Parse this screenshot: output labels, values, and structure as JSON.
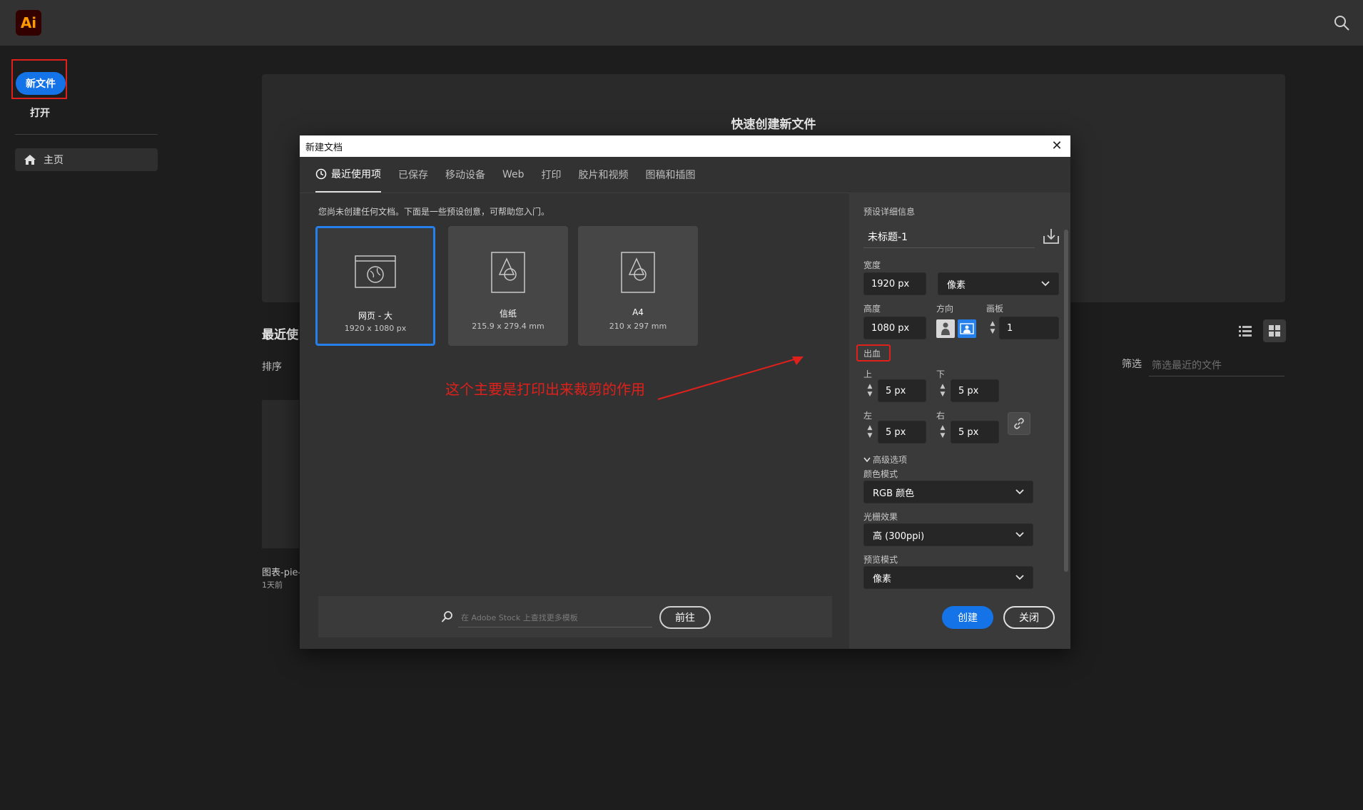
{
  "app": {
    "logo_text": "Ai"
  },
  "sidebar": {
    "new_file_label": "新文件",
    "open_label": "打开",
    "home_label": "主页"
  },
  "home": {
    "hero_title": "快速创建新文件",
    "recent_title": "最近使",
    "sort_label": "排序",
    "recent_item_name": "图表-pie-",
    "recent_item_time": "1天前",
    "filter_label": "筛选",
    "filter_placeholder": "筛选最近的文件"
  },
  "dialog": {
    "title": "新建文档",
    "close_glyph": "✕",
    "tabs": [
      "最近使用项",
      "已保存",
      "移动设备",
      "Web",
      "打印",
      "胶片和视频",
      "图稿和插图"
    ],
    "intro": "您尚未创建任何文档。下面是一些预设创意，可帮助您入门。",
    "presets": [
      {
        "name": "网页 - 大",
        "size": "1920 x 1080 px"
      },
      {
        "name": "信纸",
        "size": "215.9 x 279.4 mm"
      },
      {
        "name": "A4",
        "size": "210 x 297 mm"
      }
    ],
    "annotation": "这个主要是打印出来裁剪的作用",
    "stock_placeholder": "在 Adobe Stock 上查找更多模板",
    "stock_go": "前往"
  },
  "details": {
    "header": "预设详细信息",
    "doc_name": "未标题-1",
    "width_label": "宽度",
    "width_value": "1920 px",
    "unit_value": "像素",
    "height_label": "高度",
    "height_value": "1080 px",
    "orientation_label": "方向",
    "artboards_label": "画板",
    "artboards_value": "1",
    "bleed_label": "出血",
    "top_label": "上",
    "top_value": "5 px",
    "bottom_label": "下",
    "bottom_value": "5 px",
    "left_label": "左",
    "left_value": "5 px",
    "right_label": "右",
    "right_value": "5 px",
    "advanced_label": "高级选项",
    "color_mode_label": "颜色模式",
    "color_mode_value": "RGB 颜色",
    "raster_label": "光栅效果",
    "raster_value": "高 (300ppi)",
    "preview_label": "预览模式",
    "preview_value": "像素",
    "create_label": "创建",
    "close_label": "关闭"
  },
  "colors": {
    "accent": "#1473e6",
    "annotation": "#e0201b",
    "logo_bg": "#330000",
    "logo_fg": "#ff9a00"
  }
}
